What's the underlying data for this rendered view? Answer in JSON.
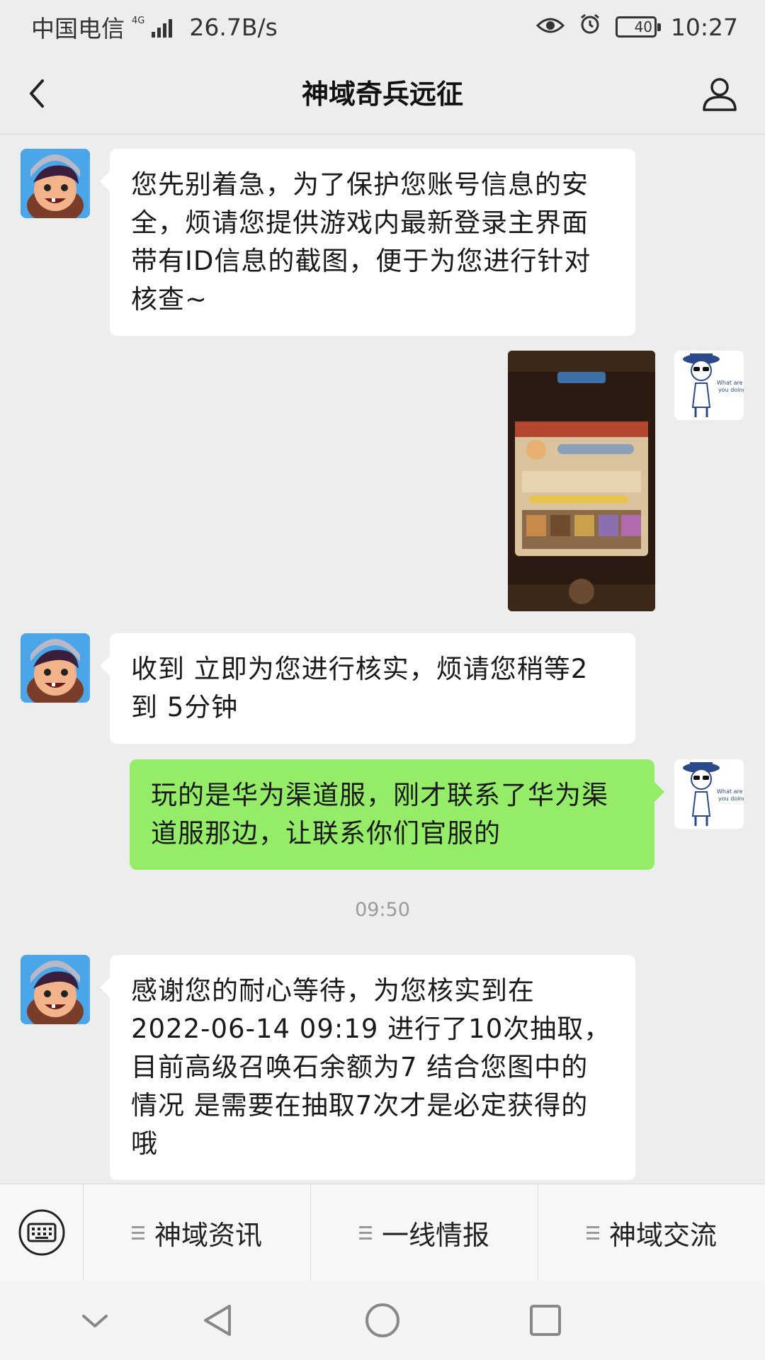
{
  "status_bar": {
    "carrier": "中国电信",
    "network_type": "4G",
    "speed": "26.7B/s",
    "battery": "40",
    "time": "10:27"
  },
  "header": {
    "title": "神域奇兵远征"
  },
  "messages": {
    "m1": {
      "sender": "official",
      "text": "您先别着急，为了保护您账号信息的安全，烦请您提供游戏内最新登录主界面带有ID信息的截图，便于为您进行针对核查~"
    },
    "m2": {
      "sender": "user",
      "type": "image"
    },
    "m3": {
      "sender": "official",
      "text": "收到 立即为您进行核实，烦请您稍等2 到 5分钟"
    },
    "m4": {
      "sender": "user",
      "text": "玩的是华为渠道服，刚才联系了华为渠道服那边，让联系你们官服的"
    },
    "timestamp": "09:50",
    "m5": {
      "sender": "official",
      "text": "感谢您的耐心等待，为您核实到在2022-06-14 09:19 进行了10次抽取，目前高级召唤石余额为7 结合您图中的情况 是需要在抽取7次才是必定获得的哦"
    }
  },
  "bottom_menu": {
    "items": [
      {
        "label": "神域资讯"
      },
      {
        "label": "一线情报"
      },
      {
        "label": "神域交流"
      }
    ]
  },
  "icons": {
    "back": "chevron-left-icon",
    "profile": "person-icon",
    "keyboard": "keyboard-icon",
    "menu": "menu-lines-icon",
    "nav_down": "chevron-down-icon",
    "nav_back": "triangle-back-icon",
    "nav_home": "circle-home-icon",
    "nav_recent": "square-recent-icon"
  },
  "colors": {
    "outgoing_bubble": "#95ec69",
    "incoming_bubble": "#ffffff",
    "background": "#ededed"
  }
}
